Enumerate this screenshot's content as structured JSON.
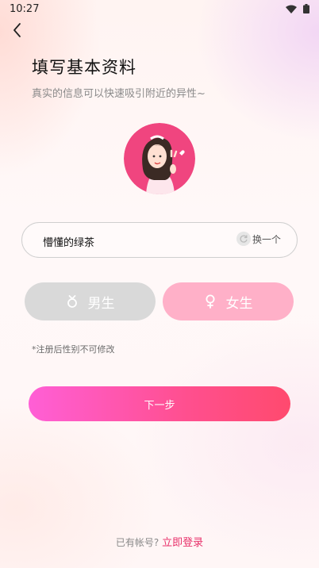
{
  "status_bar": {
    "time": "10:27"
  },
  "header": {
    "back_icon": "chevron-left-icon"
  },
  "page": {
    "title": "填写基本资料",
    "subtitle": "真实的信息可以快速吸引附近的异性~"
  },
  "nickname": {
    "value": "懵懂的绿茶",
    "swap_label": "换一个"
  },
  "gender": {
    "male_label": "男生",
    "female_label": "女生",
    "male_icon": "male-symbol-icon",
    "female_icon": "female-symbol-icon",
    "colors": {
      "male": "#d9d9d9",
      "female": "#ffb0c8"
    }
  },
  "note": "*注册后性别不可修改",
  "next_label": "下一步",
  "footer": {
    "prompt": "已有帐号?",
    "login_link": "立即登录"
  },
  "colors": {
    "accent": "#ff4f8f",
    "link": "#e8306a"
  }
}
